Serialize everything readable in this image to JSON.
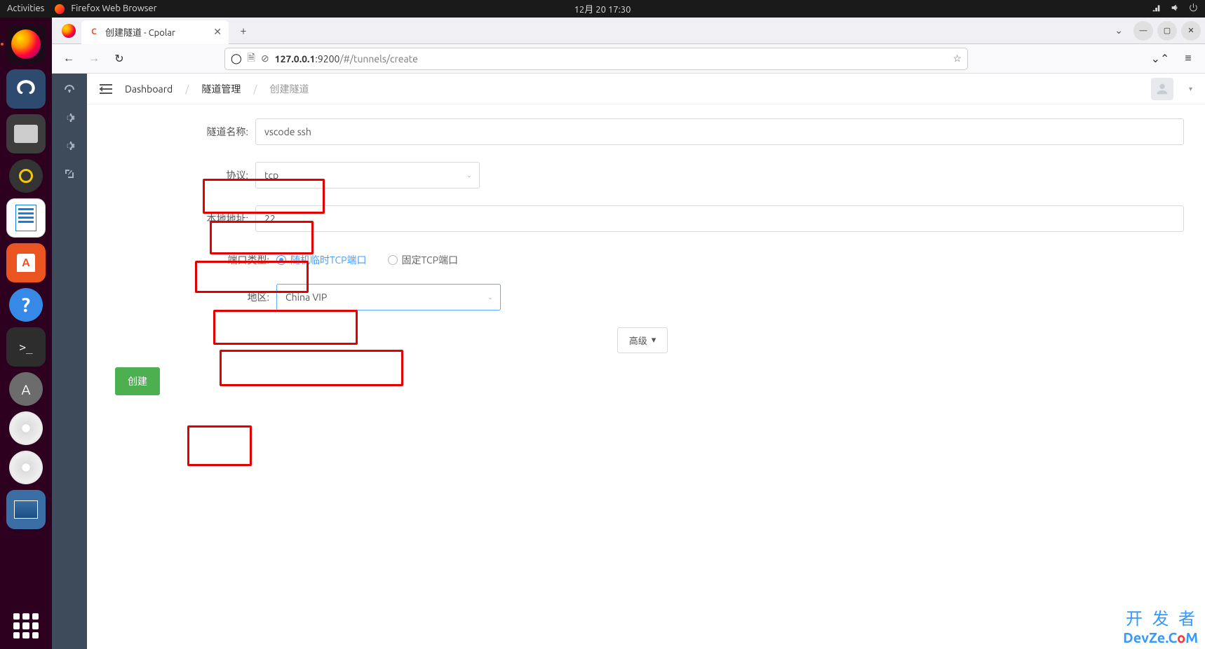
{
  "gnome": {
    "activities": "Activities",
    "app_name": "Firefox Web Browser",
    "clock": "12月 20  17:30"
  },
  "firefox": {
    "tab_title": "创建隧道 - Cpolar",
    "tab_favicon_letter": "C",
    "url_host": "127.0.0.1",
    "url_port": ":9200",
    "url_path": "/#/tunnels/create"
  },
  "breadcrumbs": {
    "item1": "Dashboard",
    "item2": "隧道管理",
    "item3": "创建隧道"
  },
  "form": {
    "tunnel_name_label": "隧道名称:",
    "tunnel_name_value": "vscode ssh",
    "protocol_label": "协议:",
    "protocol_value": "tcp",
    "local_addr_label": "本地地址:",
    "local_addr_value": "22",
    "port_type_label": "端口类型:",
    "port_type_opt1": "随机临时TCP端口",
    "port_type_opt2": "固定TCP端口",
    "region_label": "地区:",
    "region_value": "China VIP",
    "advanced": "高级",
    "create": "创建"
  },
  "watermark": {
    "line1": "开 发 者",
    "line2_a": "DevZe.C",
    "line2_b": "o",
    "line2_c": "M"
  }
}
